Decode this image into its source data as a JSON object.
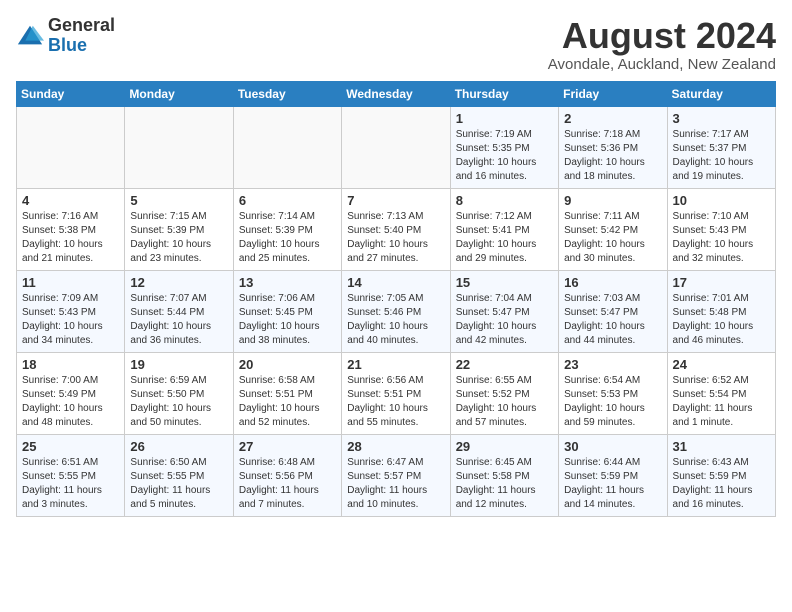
{
  "logo": {
    "general": "General",
    "blue": "Blue"
  },
  "header": {
    "month": "August 2024",
    "location": "Avondale, Auckland, New Zealand"
  },
  "weekdays": [
    "Sunday",
    "Monday",
    "Tuesday",
    "Wednesday",
    "Thursday",
    "Friday",
    "Saturday"
  ],
  "weeks": [
    [
      {
        "day": "",
        "info": ""
      },
      {
        "day": "",
        "info": ""
      },
      {
        "day": "",
        "info": ""
      },
      {
        "day": "",
        "info": ""
      },
      {
        "day": "1",
        "info": "Sunrise: 7:19 AM\nSunset: 5:35 PM\nDaylight: 10 hours\nand 16 minutes."
      },
      {
        "day": "2",
        "info": "Sunrise: 7:18 AM\nSunset: 5:36 PM\nDaylight: 10 hours\nand 18 minutes."
      },
      {
        "day": "3",
        "info": "Sunrise: 7:17 AM\nSunset: 5:37 PM\nDaylight: 10 hours\nand 19 minutes."
      }
    ],
    [
      {
        "day": "4",
        "info": "Sunrise: 7:16 AM\nSunset: 5:38 PM\nDaylight: 10 hours\nand 21 minutes."
      },
      {
        "day": "5",
        "info": "Sunrise: 7:15 AM\nSunset: 5:39 PM\nDaylight: 10 hours\nand 23 minutes."
      },
      {
        "day": "6",
        "info": "Sunrise: 7:14 AM\nSunset: 5:39 PM\nDaylight: 10 hours\nand 25 minutes."
      },
      {
        "day": "7",
        "info": "Sunrise: 7:13 AM\nSunset: 5:40 PM\nDaylight: 10 hours\nand 27 minutes."
      },
      {
        "day": "8",
        "info": "Sunrise: 7:12 AM\nSunset: 5:41 PM\nDaylight: 10 hours\nand 29 minutes."
      },
      {
        "day": "9",
        "info": "Sunrise: 7:11 AM\nSunset: 5:42 PM\nDaylight: 10 hours\nand 30 minutes."
      },
      {
        "day": "10",
        "info": "Sunrise: 7:10 AM\nSunset: 5:43 PM\nDaylight: 10 hours\nand 32 minutes."
      }
    ],
    [
      {
        "day": "11",
        "info": "Sunrise: 7:09 AM\nSunset: 5:43 PM\nDaylight: 10 hours\nand 34 minutes."
      },
      {
        "day": "12",
        "info": "Sunrise: 7:07 AM\nSunset: 5:44 PM\nDaylight: 10 hours\nand 36 minutes."
      },
      {
        "day": "13",
        "info": "Sunrise: 7:06 AM\nSunset: 5:45 PM\nDaylight: 10 hours\nand 38 minutes."
      },
      {
        "day": "14",
        "info": "Sunrise: 7:05 AM\nSunset: 5:46 PM\nDaylight: 10 hours\nand 40 minutes."
      },
      {
        "day": "15",
        "info": "Sunrise: 7:04 AM\nSunset: 5:47 PM\nDaylight: 10 hours\nand 42 minutes."
      },
      {
        "day": "16",
        "info": "Sunrise: 7:03 AM\nSunset: 5:47 PM\nDaylight: 10 hours\nand 44 minutes."
      },
      {
        "day": "17",
        "info": "Sunrise: 7:01 AM\nSunset: 5:48 PM\nDaylight: 10 hours\nand 46 minutes."
      }
    ],
    [
      {
        "day": "18",
        "info": "Sunrise: 7:00 AM\nSunset: 5:49 PM\nDaylight: 10 hours\nand 48 minutes."
      },
      {
        "day": "19",
        "info": "Sunrise: 6:59 AM\nSunset: 5:50 PM\nDaylight: 10 hours\nand 50 minutes."
      },
      {
        "day": "20",
        "info": "Sunrise: 6:58 AM\nSunset: 5:51 PM\nDaylight: 10 hours\nand 52 minutes."
      },
      {
        "day": "21",
        "info": "Sunrise: 6:56 AM\nSunset: 5:51 PM\nDaylight: 10 hours\nand 55 minutes."
      },
      {
        "day": "22",
        "info": "Sunrise: 6:55 AM\nSunset: 5:52 PM\nDaylight: 10 hours\nand 57 minutes."
      },
      {
        "day": "23",
        "info": "Sunrise: 6:54 AM\nSunset: 5:53 PM\nDaylight: 10 hours\nand 59 minutes."
      },
      {
        "day": "24",
        "info": "Sunrise: 6:52 AM\nSunset: 5:54 PM\nDaylight: 11 hours\nand 1 minute."
      }
    ],
    [
      {
        "day": "25",
        "info": "Sunrise: 6:51 AM\nSunset: 5:55 PM\nDaylight: 11 hours\nand 3 minutes."
      },
      {
        "day": "26",
        "info": "Sunrise: 6:50 AM\nSunset: 5:55 PM\nDaylight: 11 hours\nand 5 minutes."
      },
      {
        "day": "27",
        "info": "Sunrise: 6:48 AM\nSunset: 5:56 PM\nDaylight: 11 hours\nand 7 minutes."
      },
      {
        "day": "28",
        "info": "Sunrise: 6:47 AM\nSunset: 5:57 PM\nDaylight: 11 hours\nand 10 minutes."
      },
      {
        "day": "29",
        "info": "Sunrise: 6:45 AM\nSunset: 5:58 PM\nDaylight: 11 hours\nand 12 minutes."
      },
      {
        "day": "30",
        "info": "Sunrise: 6:44 AM\nSunset: 5:59 PM\nDaylight: 11 hours\nand 14 minutes."
      },
      {
        "day": "31",
        "info": "Sunrise: 6:43 AM\nSunset: 5:59 PM\nDaylight: 11 hours\nand 16 minutes."
      }
    ]
  ]
}
